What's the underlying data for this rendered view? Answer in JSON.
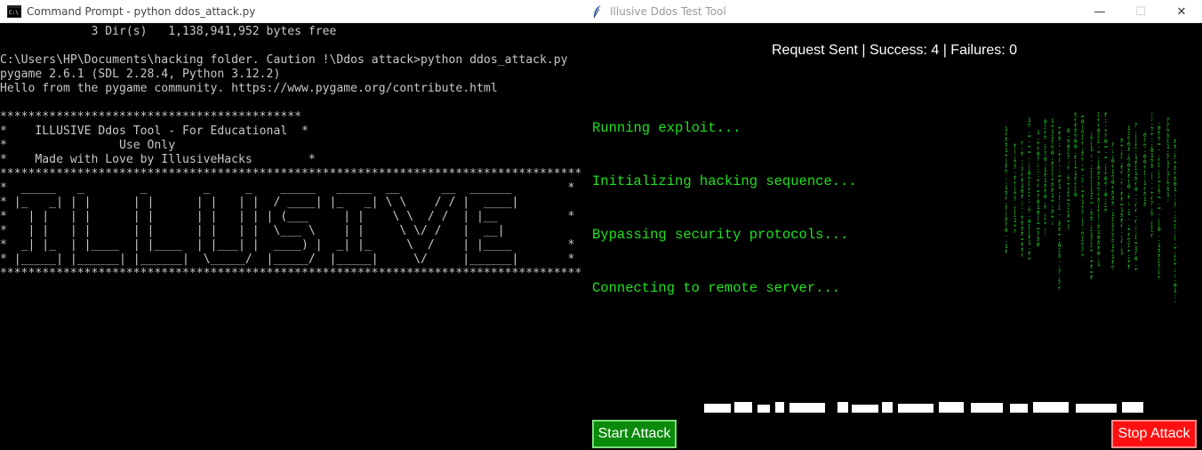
{
  "cmd_window": {
    "title": "Command Prompt - python  ddos_attack.py",
    "lines": [
      "             3 Dir(s)   1,138,941,952 bytes free",
      "",
      "C:\\Users\\HP\\Documents\\hacking folder. Caution !\\Ddos attack>python ddos_attack.py",
      "pygame 2.6.1 (SDL 2.28.4, Python 3.12.2)",
      "Hello from the pygame community. https://www.pygame.org/contribute.html",
      "",
      "*******************************************",
      "*    ILLUSIVE Ddos Tool - For Educational  *",
      "*                Use Only",
      "*    Made with Love by IllusiveHacks        *",
      "***********************************************************************************",
      "*  _____   _        _        _     _    _____   _____  __      __  ______        *",
      "* |_   _| | |      | |      | |   | |  / ____| |_   _| \\ \\    / / |  ____|",
      "*   | |   | |      | |      | |   | | | (___     | |    \\ \\  / /  | |__          *",
      "*   | |   | |      | |      | |   | |  \\___ \\    | |     \\ \\/ /   |  __|",
      "*  _| |_  | |____  | |____  | |___| |  ____) |  _| |_     \\  /    | |____        *",
      "* |_____| |______| |______|  \\_____/  |_____/  |_____|     \\/     |______|       *",
      "***********************************************************************************"
    ]
  },
  "tool_window": {
    "title": "Illusive Ddos Test Tool",
    "status_text": "Request Sent | Success: 4 | Failures: 0",
    "logs": [
      "Running exploit...",
      "Initializing hacking sequence...",
      "Bypassing security protocols...",
      "Connecting to remote server..."
    ],
    "start_label": "Start Attack",
    "stop_label": "Stop Attack"
  },
  "window_controls": {
    "minimize": "—",
    "maximize": "☐",
    "close": "✕"
  },
  "colors": {
    "console_text": "#c8c8c8",
    "log_text": "#1ee21e",
    "start_button": "#0a8a0a",
    "stop_button": "#ff1010"
  }
}
